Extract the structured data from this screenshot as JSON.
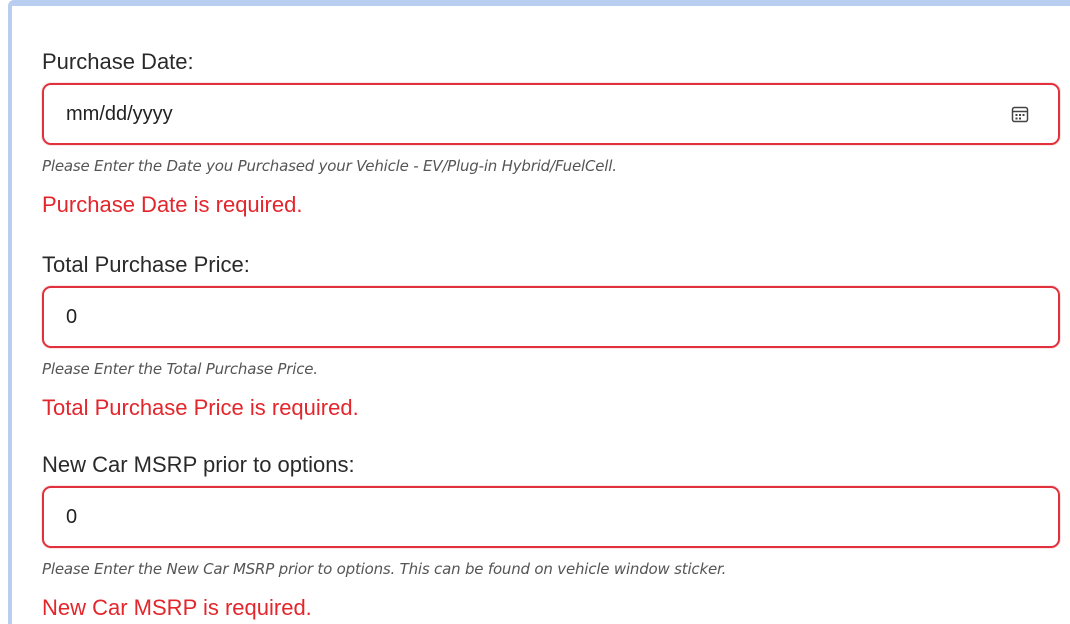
{
  "form": {
    "fields": [
      {
        "label": "Purchase Date:",
        "value": "mm/dd/yyyy",
        "help": "Please Enter the Date you Purchased your Vehicle - EV/Plug-in Hybrid/FuelCell.",
        "error": "Purchase Date is required.",
        "icon": "calendar-icon"
      },
      {
        "label": "Total Purchase Price:",
        "value": "0",
        "help": "Please Enter the Total Purchase Price.",
        "error": "Total Purchase Price is required."
      },
      {
        "label": "New Car MSRP prior to options:",
        "value": "0",
        "help": "Please Enter the New Car MSRP prior to options. This can be found on vehicle window sticker.",
        "error": "New Car MSRP is required."
      }
    ]
  },
  "colors": {
    "error": "#e3262c",
    "input_border_error": "#e0313c",
    "frame_accent": "#b9cdf0",
    "help_text": "#555555"
  }
}
